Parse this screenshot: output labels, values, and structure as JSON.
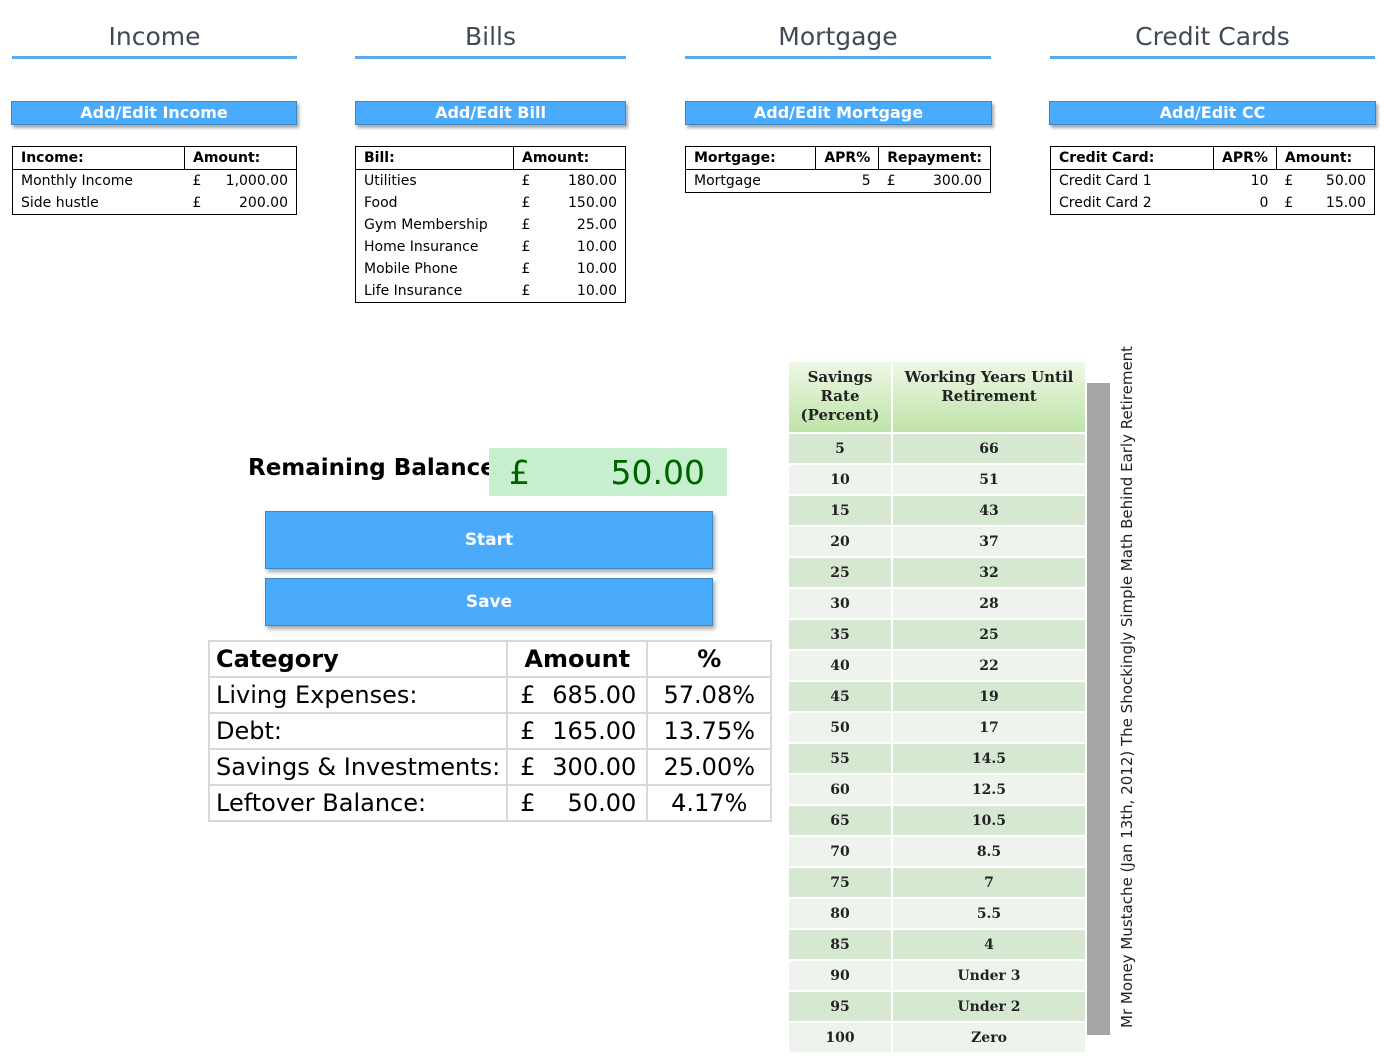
{
  "sections": {
    "income": {
      "title": "Income",
      "button": "Add/Edit Income",
      "headers": [
        "Income:",
        "Amount:"
      ],
      "rows": [
        {
          "name": "Monthly Income",
          "cur": "£",
          "amount": "1,000.00"
        },
        {
          "name": "Side hustle",
          "cur": "£",
          "amount": "200.00"
        }
      ]
    },
    "bills": {
      "title": "Bills",
      "button": "Add/Edit Bill",
      "headers": [
        "Bill:",
        "Amount:"
      ],
      "rows": [
        {
          "name": "Utilities",
          "cur": "£",
          "amount": "180.00"
        },
        {
          "name": "Food",
          "cur": "£",
          "amount": "150.00"
        },
        {
          "name": "Gym Membership",
          "cur": "£",
          "amount": "25.00"
        },
        {
          "name": "Home Insurance",
          "cur": "£",
          "amount": "10.00"
        },
        {
          "name": "Mobile Phone",
          "cur": "£",
          "amount": "10.00"
        },
        {
          "name": "Life Insurance",
          "cur": "£",
          "amount": "10.00"
        }
      ]
    },
    "mortgage": {
      "title": "Mortgage",
      "button": "Add/Edit Mortgage",
      "headers": [
        "Mortgage:",
        "APR%",
        "Repayment:"
      ],
      "rows": [
        {
          "name": "Mortgage",
          "apr": "5",
          "cur": "£",
          "amount": "300.00"
        }
      ]
    },
    "credit_cards": {
      "title": "Credit Cards",
      "button": "Add/Edit CC",
      "headers": [
        "Credit Card:",
        "APR%",
        "Amount:"
      ],
      "rows": [
        {
          "name": "Credit Card 1",
          "apr": "10",
          "cur": "£",
          "amount": "50.00"
        },
        {
          "name": "Credit Card 2",
          "apr": "0",
          "cur": "£",
          "amount": "15.00"
        }
      ]
    }
  },
  "remaining": {
    "label": "Remaining Balance:",
    "cur": "£",
    "value": "50.00"
  },
  "buttons": {
    "start": "Start",
    "save": "Save"
  },
  "summary": {
    "headers": [
      "Category",
      "Amount",
      "%"
    ],
    "rows": [
      {
        "category": "Living Expenses:",
        "cur": "£",
        "amount": "685.00",
        "pct": "57.08%"
      },
      {
        "category": "Debt:",
        "cur": "£",
        "amount": "165.00",
        "pct": "13.75%"
      },
      {
        "category": "Savings & Investments:",
        "cur": "£",
        "amount": "300.00",
        "pct": "25.00%"
      },
      {
        "category": "Leftover Balance:",
        "cur": "£",
        "amount": "50.00",
        "pct": "4.17%"
      }
    ]
  },
  "retirement": {
    "headers": [
      "Savings Rate (Percent)",
      "Working Years Until Retirement"
    ],
    "rows": [
      [
        "5",
        "66"
      ],
      [
        "10",
        "51"
      ],
      [
        "15",
        "43"
      ],
      [
        "20",
        "37"
      ],
      [
        "25",
        "32"
      ],
      [
        "30",
        "28"
      ],
      [
        "35",
        "25"
      ],
      [
        "40",
        "22"
      ],
      [
        "45",
        "19"
      ],
      [
        "50",
        "17"
      ],
      [
        "55",
        "14.5"
      ],
      [
        "60",
        "12.5"
      ],
      [
        "65",
        "10.5"
      ],
      [
        "70",
        "8.5"
      ],
      [
        "75",
        "7"
      ],
      [
        "80",
        "5.5"
      ],
      [
        "85",
        "4"
      ],
      [
        "90",
        "Under 3"
      ],
      [
        "95",
        "Under 2"
      ],
      [
        "100",
        "Zero"
      ]
    ],
    "credit": "Mr Money Mustache (Jan 13th, 2012) The Shockingly Simple Math Behind Early Retirement"
  }
}
